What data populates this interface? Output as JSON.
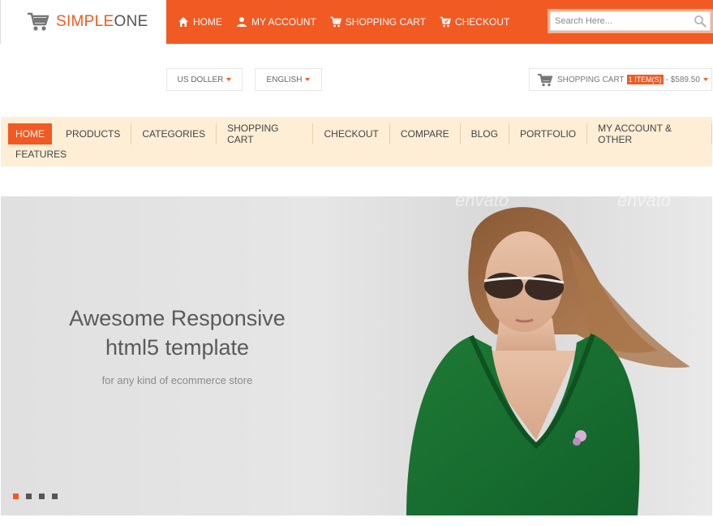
{
  "brand": {
    "name_part1": "SIMPLE",
    "name_part2": "ONE",
    "accent": "#f15a22"
  },
  "top_nav": [
    {
      "label": "HOME",
      "icon": "home-icon"
    },
    {
      "label": "MY ACCOUNT",
      "icon": "user-icon"
    },
    {
      "label": "SHOPPING CART",
      "icon": "cart-icon"
    },
    {
      "label": "CHECKOUT",
      "icon": "checkout-icon"
    }
  ],
  "search": {
    "placeholder": "Search Here...",
    "icon": "search-icon"
  },
  "currency": {
    "selected": "US DOLLER"
  },
  "language": {
    "selected": "ENGLISH"
  },
  "cart_summary": {
    "label": "SHOPPING CART",
    "items": "1 ITEM(S)",
    "total": "- $589.50"
  },
  "main_nav": {
    "items": [
      "HOME",
      "PRODUCTS",
      "CATEGORIES",
      "SHOPPING CART",
      "CHECKOUT",
      "COMPARE",
      "BLOG",
      "PORTFOLIO",
      "MY ACCOUNT & OTHER"
    ],
    "row2": [
      "FEATURES"
    ],
    "active": "HOME"
  },
  "slider": {
    "title_line1": "Awesome Responsive",
    "title_line2": "html5 template",
    "subtitle": "for any kind of ecommerce store",
    "watermark": "envato",
    "dots_count": 4,
    "active_dot": 1
  }
}
